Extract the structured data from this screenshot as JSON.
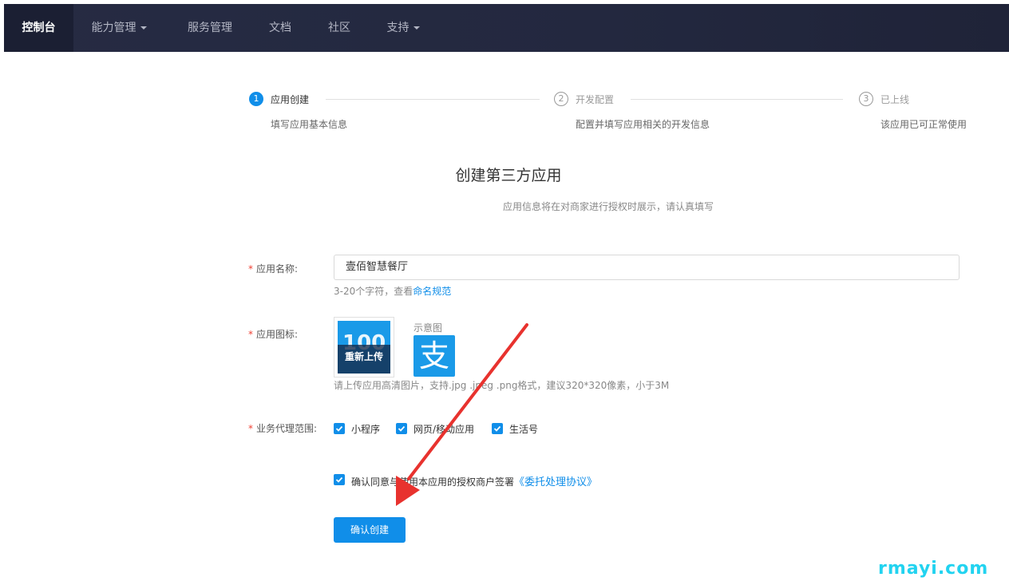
{
  "nav": {
    "items": [
      {
        "label": "控制台",
        "active": true,
        "dropdown": false
      },
      {
        "label": "能力管理",
        "active": false,
        "dropdown": true
      },
      {
        "label": "服务管理",
        "active": false,
        "dropdown": false
      },
      {
        "label": "文档",
        "active": false,
        "dropdown": false
      },
      {
        "label": "社区",
        "active": false,
        "dropdown": false
      },
      {
        "label": "支持",
        "active": false,
        "dropdown": true
      }
    ]
  },
  "steps": [
    {
      "num": "1",
      "title": "应用创建",
      "desc": "填写应用基本信息",
      "active": true
    },
    {
      "num": "2",
      "title": "开发配置",
      "desc": "配置并填写应用相关的开发信息",
      "active": false
    },
    {
      "num": "3",
      "title": "已上线",
      "desc": "该应用已可正常使用",
      "active": false
    }
  ],
  "page": {
    "title": "创建第三方应用",
    "subtitle": "应用信息将在对商家进行授权时展示，请认真填写"
  },
  "form": {
    "name_label": "应用名称:",
    "name_value": "壹佰智慧餐厅",
    "name_hint_prefix": "3-20个字符，查看",
    "name_hint_link": "命名规范",
    "icon_label": "应用图标:",
    "reupload_label": "重新上传",
    "sample_label": "示意图",
    "sample_glyph": "支",
    "icon_hint": "请上传应用高清图片，支持.jpg .jpeg .png格式，建议320*320像素，小于3M",
    "scope_label": "业务代理范围:",
    "scope_options": [
      {
        "label": "小程序",
        "checked": true
      },
      {
        "label": "网页/移动应用",
        "checked": true
      },
      {
        "label": "生活号",
        "checked": true
      }
    ],
    "agree_text": "确认同意与使用本应用的授权商户签署",
    "agree_link": "《委托处理协议》",
    "agree_checked": true,
    "submit_label": "确认创建",
    "required_mark": "*"
  },
  "watermark": "rmayi.com",
  "colors": {
    "accent": "#108ee9",
    "nav_bg": "#23283f",
    "required": "#f04134",
    "arrow": "#e8322e"
  }
}
